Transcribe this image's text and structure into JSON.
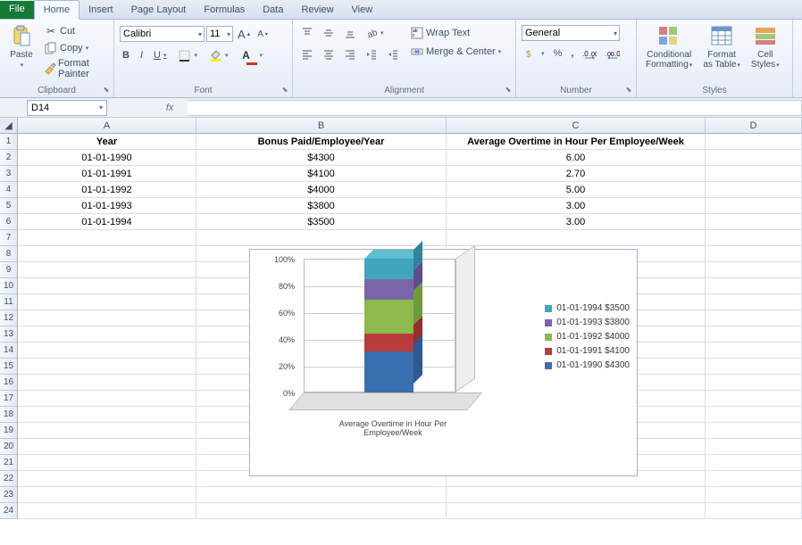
{
  "tabs": {
    "file": "File",
    "home": "Home",
    "insert": "Insert",
    "page_layout": "Page Layout",
    "formulas": "Formulas",
    "data": "Data",
    "review": "Review",
    "view": "View"
  },
  "ribbon": {
    "clipboard": {
      "paste": "Paste",
      "cut": "Cut",
      "copy": "Copy",
      "format_painter": "Format Painter",
      "label": "Clipboard"
    },
    "font": {
      "name": "Calibri",
      "size": "11",
      "grow": "A",
      "shrink": "A",
      "bold": "B",
      "italic": "I",
      "underline": "U",
      "label": "Font"
    },
    "alignment": {
      "wrap": "Wrap Text",
      "merge": "Merge & Center",
      "label": "Alignment"
    },
    "number": {
      "format": "General",
      "label": "Number"
    },
    "styles": {
      "cond": "Conditional\nFormatting",
      "table": "Format\nas Table",
      "cell": "Cell\nStyles",
      "label": "Styles"
    }
  },
  "namebox": "D14",
  "columns": [
    "A",
    "B",
    "C",
    "D"
  ],
  "headers": {
    "A": "Year",
    "B": "Bonus Paid/Employee/Year",
    "C": "Average Overtime in Hour Per Employee/Week"
  },
  "rows": [
    {
      "A": "01-01-1990",
      "B": "$4300",
      "C": "6.00"
    },
    {
      "A": "01-01-1991",
      "B": "$4100",
      "C": "2.70"
    },
    {
      "A": "01-01-1992",
      "B": "$4000",
      "C": "5.00"
    },
    {
      "A": "01-01-1993",
      "B": "$3800",
      "C": "3.00"
    },
    {
      "A": "01-01-1994",
      "B": "$3500",
      "C": "3.00"
    }
  ],
  "chart_data": {
    "type": "bar",
    "title": "",
    "xlabel": "Average Overtime in Hour Per\nEmployee/Week",
    "ylabel": "",
    "ylim": [
      0,
      100
    ],
    "y_ticks": [
      "0%",
      "20%",
      "40%",
      "60%",
      "80%",
      "100%"
    ],
    "stacked_percent": true,
    "categories": [
      "Average Overtime in Hour Per Employee/Week"
    ],
    "series": [
      {
        "name": "01-01-1990 $4300",
        "values": [
          6.0
        ],
        "color": "#3a6fb0"
      },
      {
        "name": "01-01-1991 $4100",
        "values": [
          2.7
        ],
        "color": "#b73c3c"
      },
      {
        "name": "01-01-1992 $4000",
        "values": [
          5.0
        ],
        "color": "#8bb94a"
      },
      {
        "name": "01-01-1993 $3800",
        "values": [
          3.0
        ],
        "color": "#7a65a8"
      },
      {
        "name": "01-01-1994 $3500",
        "values": [
          3.0
        ],
        "color": "#3fa6bd"
      }
    ],
    "legend": [
      "01-01-1994 $3500",
      "01-01-1993 $3800",
      "01-01-1992 $4000",
      "01-01-1991 $4100",
      "01-01-1990 $4300"
    ]
  }
}
